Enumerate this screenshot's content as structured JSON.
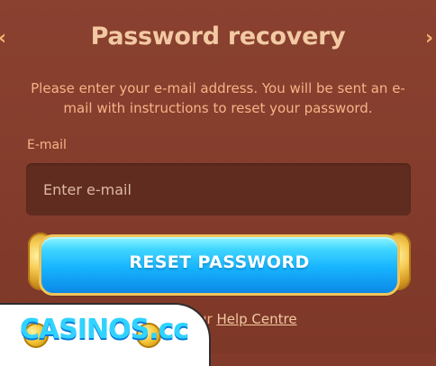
{
  "modal": {
    "title": "Password recovery",
    "description": "Please enter your e-mail address. You will be sent an e-mail with instructions to reset your password.",
    "email_label": "E-mail",
    "email_placeholder": "Enter e-mail",
    "reset_button_label": "RESET PASSWORD",
    "help_prefix": "ur ",
    "help_link_label": "Help Centre"
  },
  "icons": {
    "left_nav": "chevron-left-icon",
    "right_nav": "chevron-right-icon",
    "watermark_logo": "casinos-logo"
  },
  "watermark": {
    "text": "CASINOS.cc"
  },
  "colors": {
    "background": "#823b2b",
    "title": "#f3c9a3",
    "text": "#f6b387",
    "input_bg": "#612c20",
    "button_blue": "#17b4ff",
    "button_gold": "#f0c45a"
  }
}
